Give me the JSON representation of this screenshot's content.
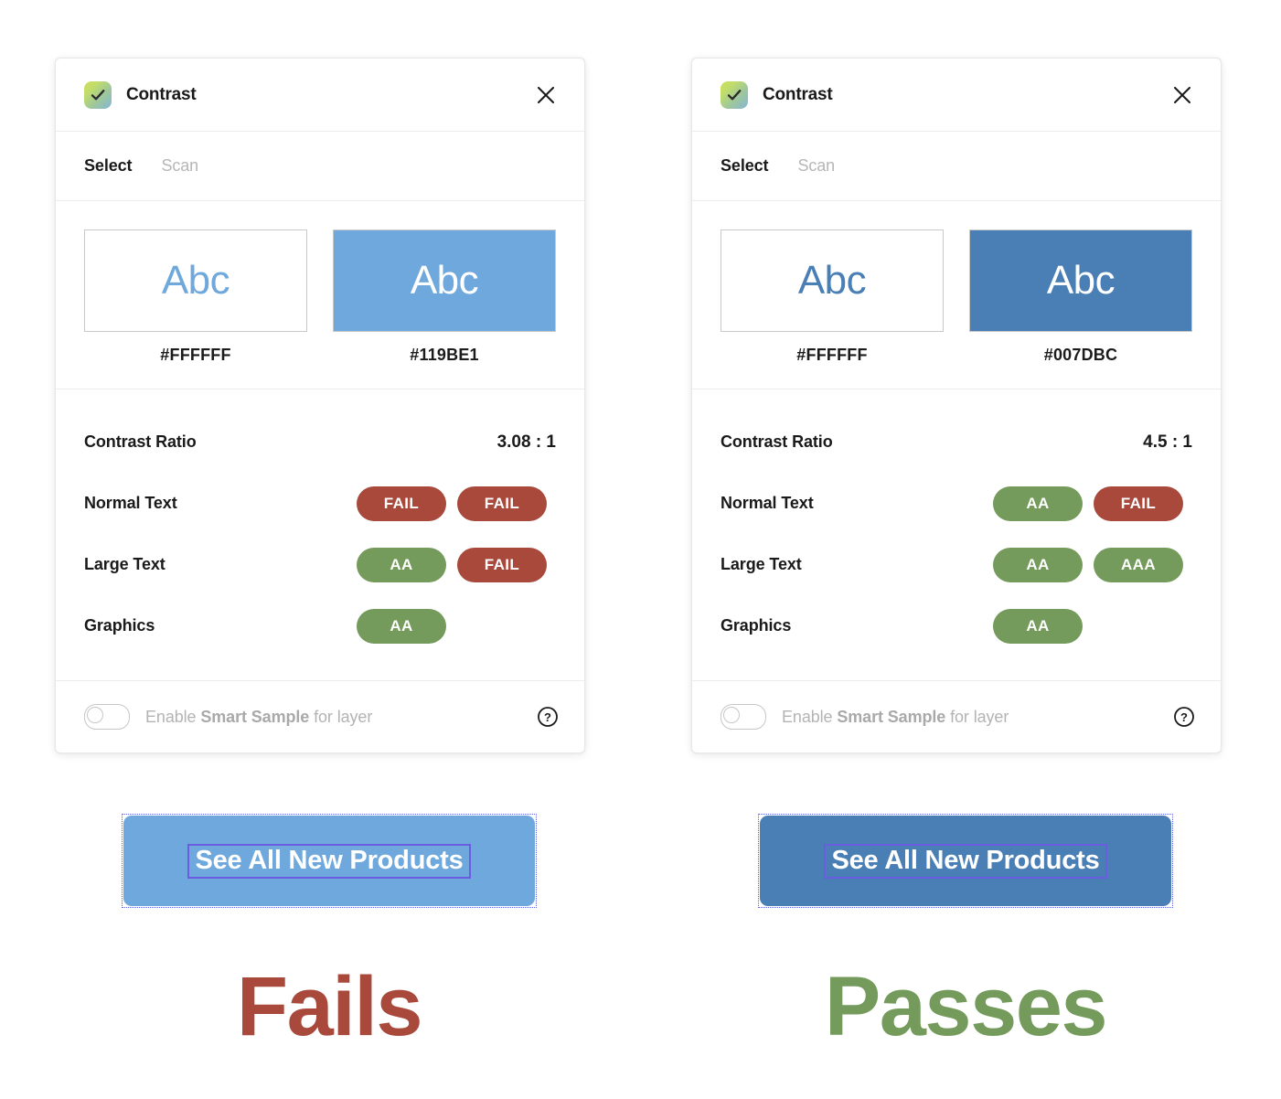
{
  "colors": {
    "fail_badge": "#A8493C",
    "pass_badge": "#749B5B",
    "fails_text": "#A8493C",
    "passes_text": "#749B5B",
    "left_blue": "#119BE1",
    "right_blue": "#007DBC",
    "selection_purple": "#6A5DE0"
  },
  "panels": [
    {
      "id": "left",
      "header": {
        "title": "Contrast",
        "icon": "contrast-checkmark-icon",
        "close_icon": "close-icon"
      },
      "tabs": [
        {
          "label": "Select",
          "active": true
        },
        {
          "label": "Scan",
          "active": false
        }
      ],
      "swatches": [
        {
          "sample_text": "Abc",
          "hex": "#FFFFFF",
          "bg": "#FFFFFF",
          "fg": "#6FA8DC"
        },
        {
          "sample_text": "Abc",
          "hex": "#119BE1",
          "bg": "#6FA8DC",
          "fg": "#FFFFFF"
        }
      ],
      "ratio": {
        "label": "Contrast Ratio",
        "value": "3.08 : 1"
      },
      "rows": [
        {
          "label": "Normal Text",
          "badges": [
            {
              "text": "FAIL",
              "state": "fail"
            },
            {
              "text": "FAIL",
              "state": "fail"
            }
          ]
        },
        {
          "label": "Large Text",
          "badges": [
            {
              "text": "AA",
              "state": "pass"
            },
            {
              "text": "FAIL",
              "state": "fail"
            }
          ]
        },
        {
          "label": "Graphics",
          "badges": [
            {
              "text": "AA",
              "state": "pass"
            }
          ]
        }
      ],
      "footer": {
        "toggle_state": "off",
        "label_prefix": "Enable ",
        "label_bold": "Smart Sample",
        "label_suffix": " for layer",
        "help_icon": "help-circle-icon"
      },
      "demo": {
        "button_label": "See All New Products",
        "button_bg": "#6FA8DC"
      },
      "verdict": {
        "text": "Fails",
        "color": "#A8493C"
      }
    },
    {
      "id": "right",
      "header": {
        "title": "Contrast",
        "icon": "contrast-checkmark-icon",
        "close_icon": "close-icon"
      },
      "tabs": [
        {
          "label": "Select",
          "active": true
        },
        {
          "label": "Scan",
          "active": false
        }
      ],
      "swatches": [
        {
          "sample_text": "Abc",
          "hex": "#FFFFFF",
          "bg": "#FFFFFF",
          "fg": "#4A7FB5"
        },
        {
          "sample_text": "Abc",
          "hex": "#007DBC",
          "bg": "#4A7FB5",
          "fg": "#FFFFFF"
        }
      ],
      "ratio": {
        "label": "Contrast Ratio",
        "value": "4.5 : 1"
      },
      "rows": [
        {
          "label": "Normal Text",
          "badges": [
            {
              "text": "AA",
              "state": "pass"
            },
            {
              "text": "FAIL",
              "state": "fail"
            }
          ]
        },
        {
          "label": "Large Text",
          "badges": [
            {
              "text": "AA",
              "state": "pass"
            },
            {
              "text": "AAA",
              "state": "pass"
            }
          ]
        },
        {
          "label": "Graphics",
          "badges": [
            {
              "text": "AA",
              "state": "pass"
            }
          ]
        }
      ],
      "footer": {
        "toggle_state": "off",
        "label_prefix": "Enable ",
        "label_bold": "Smart Sample",
        "label_suffix": " for layer",
        "help_icon": "help-circle-icon"
      },
      "demo": {
        "button_label": "See All New Products",
        "button_bg": "#4A7FB5"
      },
      "verdict": {
        "text": "Passes",
        "color": "#749B5B"
      }
    }
  ]
}
